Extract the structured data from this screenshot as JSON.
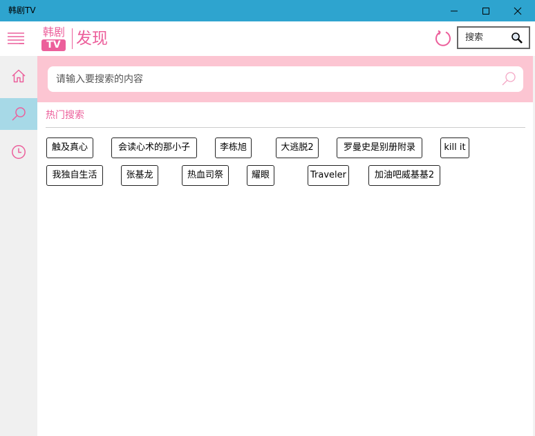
{
  "window": {
    "title": "韩剧TV"
  },
  "header": {
    "logo_top": "韩剧",
    "logo_bottom": "TV",
    "page_title": "发现",
    "search_label": "搜索"
  },
  "sidebar": {
    "items": [
      {
        "icon": "home-icon"
      },
      {
        "icon": "search-icon",
        "active": true
      },
      {
        "icon": "history-icon"
      }
    ]
  },
  "search": {
    "placeholder": "请输入要搜索的内容",
    "value": ""
  },
  "hot": {
    "title": "热门搜索",
    "tags": [
      "触及真心",
      "会读心术的那小子",
      "李栋旭",
      "大逃脱2",
      "罗曼史是别册附录",
      "kill it",
      "我独自生活",
      "张基龙",
      "热血司祭",
      "耀眼",
      "Traveler",
      "加油吧威基基2"
    ]
  },
  "colors": {
    "accent": "#ec5f9b",
    "titlebar": "#2ea4cf",
    "banner": "#fcc5d2",
    "nav_active": "#a7d9e7"
  }
}
